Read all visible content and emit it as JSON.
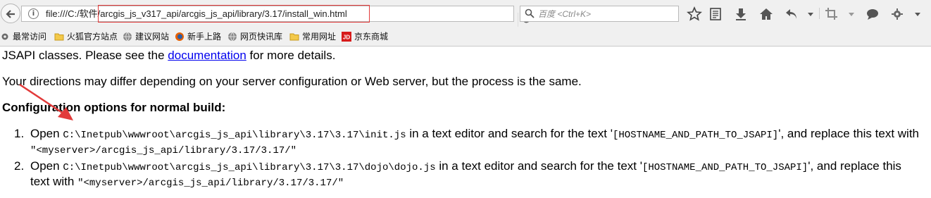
{
  "toolbar": {
    "url": "file:///C:/软件/arcgis_js_v317_api/arcgis_js_api/library/3.17/install_win.html",
    "search_placeholder": "百度 <Ctrl+K>",
    "icons": [
      "back-icon",
      "info-icon",
      "reload-icon",
      "search-icon",
      "star-icon",
      "reading-list-icon",
      "download-icon",
      "home-icon",
      "undo-icon",
      "dropdown-icon",
      "crop-icon",
      "dropdown-icon",
      "chat-icon",
      "settings-icon",
      "dropdown-icon"
    ]
  },
  "bookmarks": [
    {
      "label": "最常访问",
      "icon": "gear-icon"
    },
    {
      "label": "火狐官方站点",
      "icon": "folder-icon"
    },
    {
      "label": "建议网站",
      "icon": "globe-icon"
    },
    {
      "label": "新手上路",
      "icon": "firefox-icon"
    },
    {
      "label": "网页快讯库",
      "icon": "globe-icon"
    },
    {
      "label": "常用网址",
      "icon": "folder-icon"
    },
    {
      "label": "京东商城",
      "icon": "jd-icon"
    }
  ],
  "content": {
    "p1_prefix": "JSAPI classes. Please see the ",
    "p1_link": "documentation",
    "p1_suffix": " for more details.",
    "p2": "Your directions may differ depending on your server configuration or Web server, but the process is the same.",
    "heading": "Configuration options for normal build:",
    "steps": [
      {
        "num": "1.",
        "t1": "Open ",
        "path": "C:\\Inetpub\\wwwroot\\arcgis_js_api\\library\\3.17\\3.17\\init.js",
        "t2": " in a text editor and search for the text '",
        "token": "[HOSTNAME_AND_PATH_TO_JSAPI]",
        "t3": "', and replace this text with ",
        "replacement": "\"<myserver>/arcgis_js_api/library/3.17/3.17/\""
      },
      {
        "num": "2.",
        "t1": "Open ",
        "path": "C:\\Inetpub\\wwwroot\\arcgis_js_api\\library\\3.17\\3.17\\dojo\\dojo.js",
        "t2": " in a text editor and search for the text '",
        "token": "[HOSTNAME_AND_PATH_TO_JSAPI]",
        "t3": "', and replace this text with ",
        "replacement": "\"<myserver>/arcgis_js_api/library/3.17/3.17/\""
      }
    ]
  },
  "colors": {
    "link": "#0000ee",
    "highlight_box": "#e23a3a",
    "arrow": "#e23a3a",
    "chrome_bg": "#f0f0f0"
  }
}
